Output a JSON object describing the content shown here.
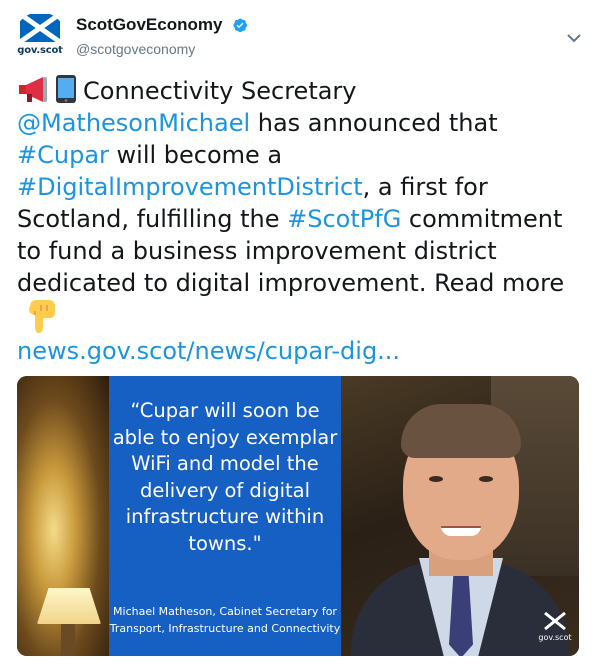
{
  "tweet": {
    "avatar_text": "gov.scot",
    "display_name": "ScotGovEconomy",
    "handle": "@scotgoveconomy",
    "verified": true,
    "text": {
      "line1_text": "Connectivity Secretary",
      "mention": "@MathesonMichael",
      "after_mention": " has announced that",
      "hashtag_cupar": "#Cupar",
      "after_cupar": " will become a",
      "hashtag_district": "#DigitalImprovementDistrict",
      "after_district": ", a first for Scotland, fulfilling the ",
      "hashtag_pfg": "#ScotPfG",
      "after_pfg": " commitment to fund a business improvement district dedicated to digital improvement. Read more",
      "link": "news.gov.scot/news/cupar-dig..."
    },
    "emoji": [
      "megaphone-icon",
      "mobile-phone-icon",
      "pointing-down-hand-icon"
    ]
  },
  "media": {
    "quote": "“Cupar will soon be able to enjoy exemplar WiFi and model the delivery of digital infrastructure within towns.\"",
    "credit": "Michael Matheson, Cabinet Secretary for Transport, Infrastructure and Connectivity",
    "logo_text": "gov.scot"
  },
  "colors": {
    "link": "#1b95e0",
    "panel_blue": "#1660c4",
    "saltire_blue": "#0065bd"
  }
}
